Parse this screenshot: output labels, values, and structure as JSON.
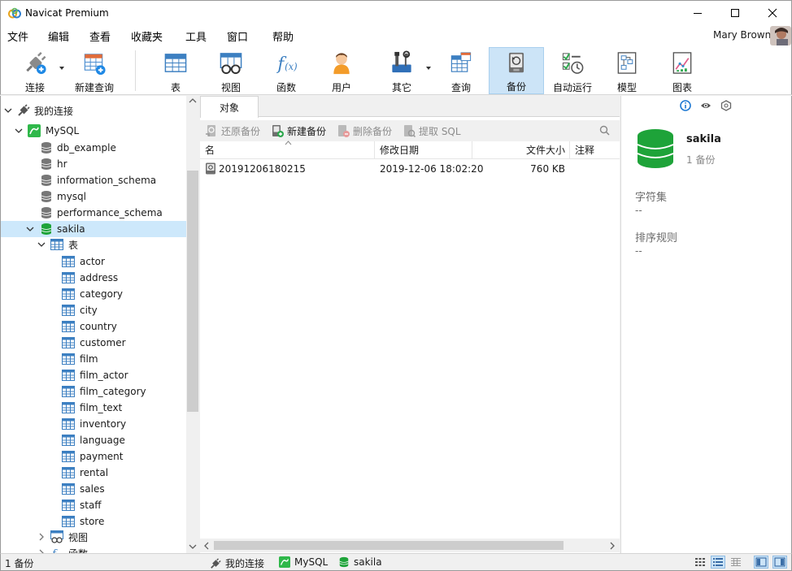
{
  "window": {
    "title": "Navicat Premium"
  },
  "menu": {
    "items": [
      "文件",
      "编辑",
      "查看",
      "收藏夹",
      "工具",
      "窗口",
      "帮助"
    ]
  },
  "user": {
    "name": "Mary Brown"
  },
  "toolbar": {
    "connect": "连接",
    "new_query": "新建查询",
    "table": "表",
    "view": "视图",
    "function": "函数",
    "user": "用户",
    "other": "其它",
    "query": "查询",
    "backup": "备份",
    "automation": "自动运行",
    "model": "模型",
    "chart": "图表"
  },
  "tree": {
    "root": "我的连接",
    "connection": "MySQL",
    "databases": [
      "db_example",
      "hr",
      "information_schema",
      "mysql",
      "performance_schema"
    ],
    "selected_db": "sakila",
    "tables_group": "表",
    "tables": [
      "actor",
      "address",
      "category",
      "city",
      "country",
      "customer",
      "film",
      "film_actor",
      "film_category",
      "film_text",
      "inventory",
      "language",
      "payment",
      "rental",
      "sales",
      "staff",
      "store"
    ],
    "views_group": "视图",
    "functions_group": "函数"
  },
  "tabs": {
    "objects": "对象"
  },
  "subtoolbar": {
    "restore": "还原备份",
    "new_backup": "新建备份",
    "delete_backup": "删除备份",
    "extract_sql": "提取 SQL"
  },
  "columns": {
    "name": "名",
    "modified": "修改日期",
    "size": "文件大小",
    "comment": "注释"
  },
  "backups": [
    {
      "name": "20191206180215",
      "modified": "2019-12-06 18:02:20",
      "size": "760 KB",
      "comment": ""
    }
  ],
  "details": {
    "db_name": "sakila",
    "count": "1 备份",
    "charset_label": "字符集",
    "charset_value": "--",
    "collation_label": "排序规则",
    "collation_value": "--"
  },
  "status": {
    "left": "1 备份",
    "conn": "我的连接",
    "server": "MySQL",
    "db": "sakila"
  },
  "colors": {
    "accent": "#cce4f7",
    "db_green": "#1ea339",
    "mysql_green": "#2fb84a",
    "table_blue": "#3c7fc1"
  }
}
